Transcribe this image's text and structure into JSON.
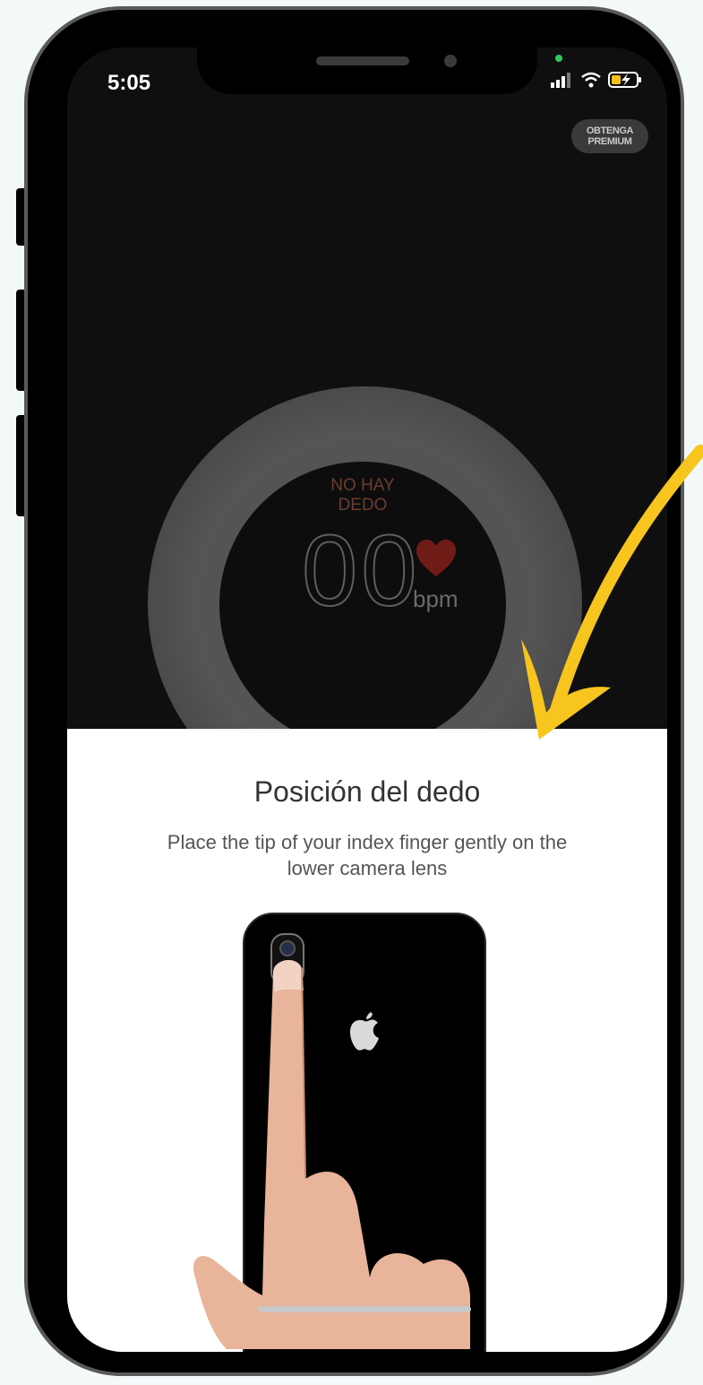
{
  "status_bar": {
    "time": "5:05",
    "icons": [
      "signal-icon",
      "wifi-icon",
      "battery-charging-icon"
    ]
  },
  "header": {
    "premium_line1": "OBTENGA",
    "premium_line2": "PREMIUM"
  },
  "monitor": {
    "status_line1": "NO HAY",
    "status_line2": "DEDO",
    "bpm_value": "00",
    "bpm_unit": "bpm",
    "icon": "heart-icon"
  },
  "instructions": {
    "title": "Posición del dedo",
    "description": "Place the tip of your index finger gently on the lower camera lens",
    "illustration": "finger-on-camera-illustration"
  },
  "colors": {
    "accent_arrow": "#f7c51e",
    "heart": "#6f1b16",
    "status_dot": "#35c759"
  }
}
